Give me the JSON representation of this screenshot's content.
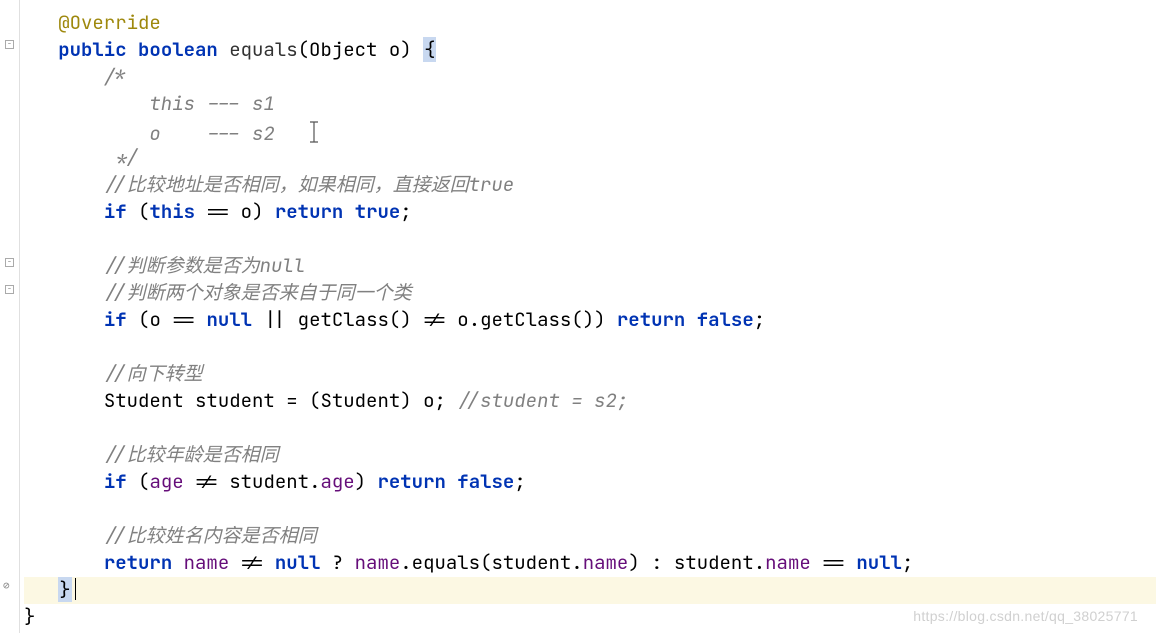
{
  "code": {
    "line1": "   @Override",
    "line2_pre": "   ",
    "line2_public": "public",
    "line2_boolean": "boolean",
    "line2_equals": "equals",
    "line2_object": "Object",
    "line2_param": "o",
    "line3": "       /*",
    "line4": "           this --- s1",
    "line5_pre": "           o    --- s2   ",
    "line6": "        */",
    "line7": "       //比较地址是否相同，如果相同，直接返回true",
    "line8_pre": "       ",
    "line8_if": "if",
    "line8_lparen": " (",
    "line8_this": "this",
    "line8_eq": " == ",
    "line8_o": "o",
    "line8_rparen": ") ",
    "line8_return": "return",
    "line8_sp": " ",
    "line8_true": "true",
    "line8_semi": ";",
    "line9": "",
    "line10": "       //判断参数是否为null",
    "line11": "       //判断两个对象是否来自于同一个类",
    "line12_pre": "       ",
    "line12_if": "if",
    "line12_lparen": " (",
    "line12_o": "o",
    "line12_eq": " == ",
    "line12_null": "null",
    "line12_or": " || ",
    "line12_getclass1": "getClass",
    "line12_call1": "() != ",
    "line12_o2": "o",
    "line12_dot": ".",
    "line12_getclass2": "getClass",
    "line12_call2": "()) ",
    "line12_return": "return",
    "line12_sp": " ",
    "line12_false": "false",
    "line12_semi": ";",
    "line13": "",
    "line14": "       //向下转型",
    "line15_pre": "       ",
    "line15_type": "Student ",
    "line15_var": "student",
    "line15_eq": " = (",
    "line15_cast": "Student",
    "line15_rparen": ") ",
    "line15_o": "o",
    "line15_semi": "; ",
    "line15_comment": "//student = s2;",
    "line16": "",
    "line17": "       //比较年龄是否相同",
    "line18_pre": "       ",
    "line18_if": "if",
    "line18_lparen": " (",
    "line18_age1": "age",
    "line18_ne": " != ",
    "line18_student": "student",
    "line18_dot": ".",
    "line18_age2": "age",
    "line18_rparen": ") ",
    "line18_return": "return",
    "line18_sp": " ",
    "line18_false": "false",
    "line18_semi": ";",
    "line19": "",
    "line20": "       //比较姓名内容是否相同",
    "line21_pre": "       ",
    "line21_return": "return",
    "line21_sp1": " ",
    "line21_name1": "name",
    "line21_ne": " != ",
    "line21_null": "null",
    "line21_q": " ? ",
    "line21_name2": "name",
    "line21_dot1": ".",
    "line21_equals": "equals",
    "line21_lparen": "(",
    "line21_student1": "student",
    "line21_dot2": ".",
    "line21_name3": "name",
    "line21_rparen": ") : ",
    "line21_student2": "student",
    "line21_dot3": ".",
    "line21_name4": "name",
    "line21_eq": " == ",
    "line21_null2": "null",
    "line21_semi": ";",
    "line22_pre": "   ",
    "line22_brace": "}",
    "line23": "}"
  },
  "watermark": "https://blog.csdn.net/qq_38025771"
}
